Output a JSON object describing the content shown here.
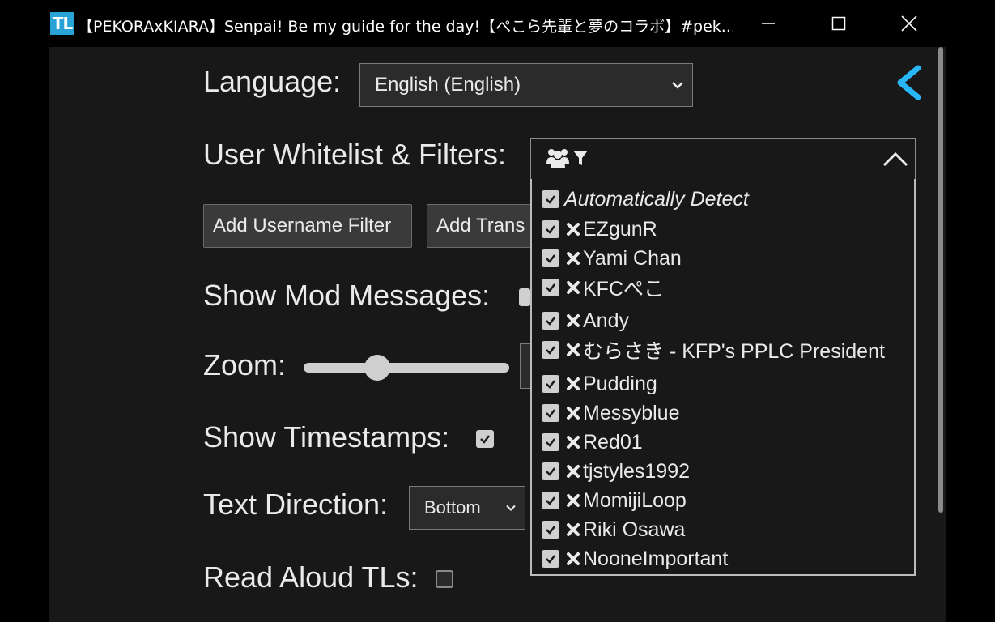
{
  "window": {
    "app_icon": "TL",
    "title": "【PEKORAxKIARA】Senpai! Be my guide for the day!【ぺこら先輩と夢のコラボ】#pek...",
    "controls": [
      "minimize-icon",
      "maximize-icon",
      "close-icon"
    ]
  },
  "settings": {
    "language_label": "Language:",
    "language_value": "English (English)",
    "whitelist_label": "User Whitelist & Filters:",
    "add_username_filter": "Add Username Filter",
    "add_translation_filter": "Add Trans",
    "show_mod_label": "Show Mod Messages:",
    "zoom_label": "Zoom:",
    "zoom_level": 0.36,
    "show_timestamps_label": "Show Timestamps:",
    "show_timestamps_checked": true,
    "text_direction_label": "Text Direction:",
    "text_direction_value": "Bottom",
    "read_aloud_label": "Read Aloud TLs:",
    "read_aloud_checked": false
  },
  "dropdown": {
    "icons": [
      "users-icon",
      "filter-icon"
    ],
    "expanded": true,
    "items": [
      {
        "label": "Automatically Detect",
        "checked": true,
        "removable": false
      },
      {
        "label": "EZgunR",
        "checked": true,
        "removable": true
      },
      {
        "label": "Yami Chan",
        "checked": true,
        "removable": true
      },
      {
        "label": "KFCぺこ",
        "checked": true,
        "removable": true
      },
      {
        "label": "Andy",
        "checked": true,
        "removable": true
      },
      {
        "label": "むらさき - KFP's PPLC President",
        "checked": true,
        "removable": true
      },
      {
        "label": "Pudding",
        "checked": true,
        "removable": true
      },
      {
        "label": "Messyblue",
        "checked": true,
        "removable": true
      },
      {
        "label": "Red01",
        "checked": true,
        "removable": true
      },
      {
        "label": "tjstyles1992",
        "checked": true,
        "removable": true
      },
      {
        "label": "MomijiLoop",
        "checked": true,
        "removable": true
      },
      {
        "label": "Riki Osawa",
        "checked": true,
        "removable": true
      },
      {
        "label": "NooneImportant",
        "checked": true,
        "removable": true
      }
    ]
  },
  "colors": {
    "accent": "#29b6f6",
    "background": "#181818",
    "titlebar": "#000000"
  }
}
